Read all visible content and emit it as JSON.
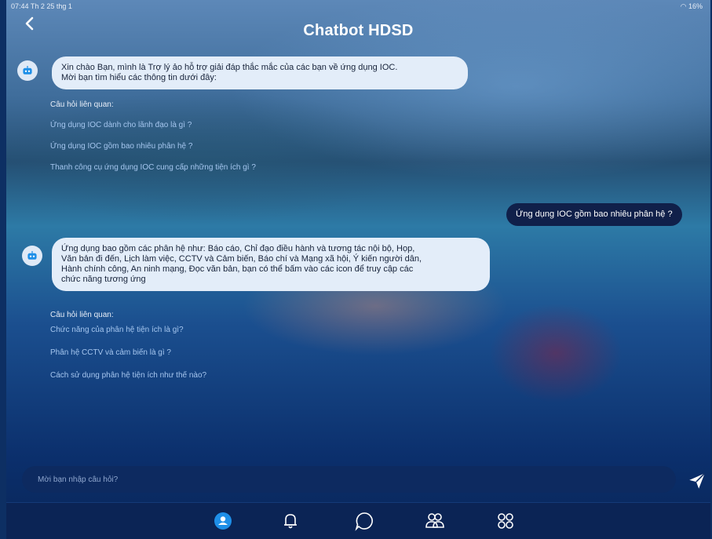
{
  "status_bar": {
    "left_text": "07:44  Th 2 25 thg 1",
    "right_text": "16%"
  },
  "header": {
    "title": "Chatbot HDSD"
  },
  "chat": {
    "bot_message_1": {
      "line1": "Xin chào Bạn, mình là Trợ lý ảo hỗ trợ giải đáp thắc mắc của các bạn về ứng dụng IOC.",
      "line2": "Mời bạn tìm hiểu các thông tin dưới đây:"
    },
    "related_1": {
      "title": "Câu hỏi liên quan:",
      "items": [
        "Ứng dụng IOC dành cho lãnh đạo là gì ?",
        "Ứng dụng IOC gồm bao nhiêu phân hệ ?",
        "Thanh công cụ ứng dụng IOC cung cấp những tiện ích gì ?"
      ]
    },
    "user_message": "Ứng dụng IOC gồm bao nhiêu phân hệ ?",
    "bot_message_2": {
      "line1": "Ứng dụng bao gồm các phân hệ như: Báo cáo, Chỉ đạo điều hành và tương tác nội bộ, Họp,",
      "line2": "Văn bản đi đến, Lịch làm việc, CCTV và Cảm biến, Báo chí và Mạng xã hội, Ý kiến người dân,",
      "line3": "Hành chính công, An ninh mạng, Đọc văn bản, bạn có thể bấm vào các icon để truy cập các",
      "line4": "chức năng tương ứng"
    },
    "related_2": {
      "title": "Câu hỏi liên quan:",
      "items": [
        "Chức năng của phân hệ tiện ích là gì?",
        "Phân hệ CCTV và cảm biến là gì ?",
        "Cách sử dụng phân hệ tiện ích như thế nào?"
      ]
    }
  },
  "input": {
    "placeholder": "Mời bạn nhập câu hỏi?"
  },
  "bottom_nav": {
    "items": [
      "home-icon",
      "bell-icon",
      "chat-icon",
      "users-icon",
      "apps-icon"
    ]
  },
  "colors": {
    "accent": "#1e8fe8",
    "bot_bubble": "#e3edf9",
    "user_bubble": "#10204a",
    "nav_bg": "#0b2455"
  }
}
